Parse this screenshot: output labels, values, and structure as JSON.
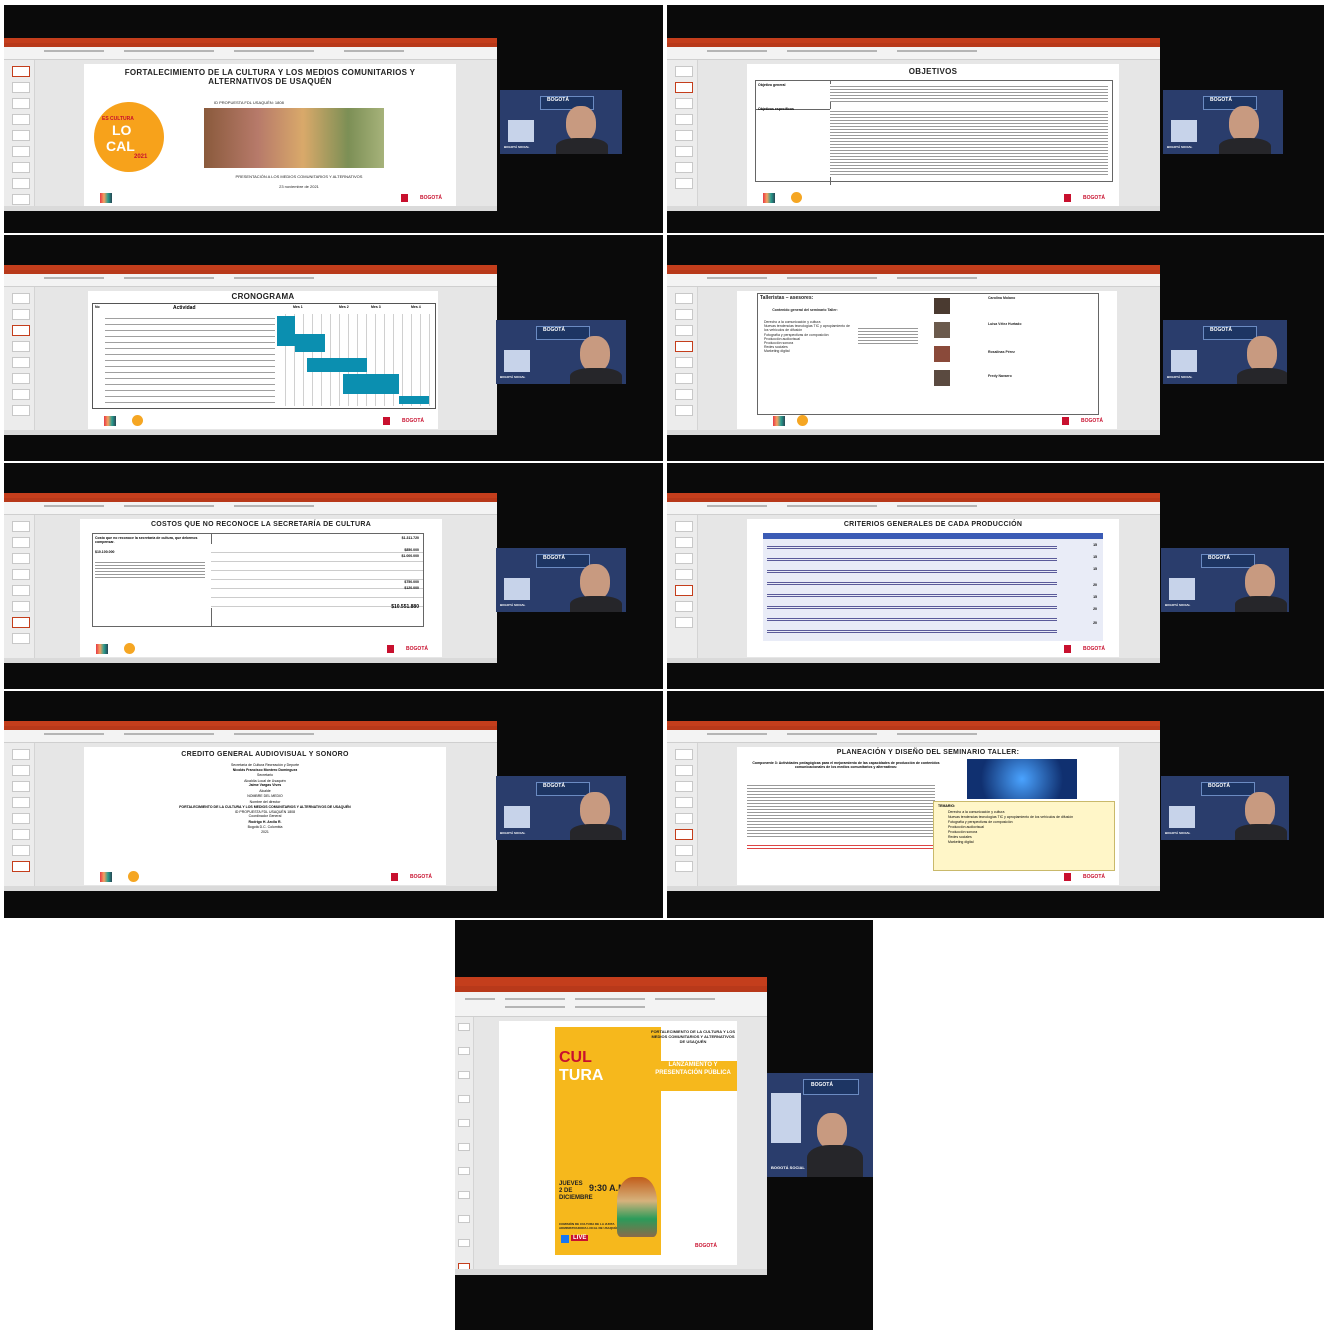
{
  "screens": [
    {
      "slide_title": "FORTALECIMIENTO DE LA CULTURA Y LOS MEDIOS COMUNITARIOS Y ALTERNATIVOS DE USAQUÉN",
      "project_id": "ID PROPUESTA FDL USAQUÉN: 1808",
      "logo_es_cultura": "ES CULTURA",
      "logo_lo": "LO",
      "logo_cal": "CAL",
      "logo_year": "2021",
      "presentation": "PRESENTACIÓN A LOS MEDIOS COMUNITARIOS Y ALTERNATIVOS",
      "date": "23 noviembre de 2021",
      "bogota": "BOGOTÁ"
    },
    {
      "slide_title": "OBJETIVOS",
      "row1_label": "Objetivo general",
      "row2_label": "Objetivos específicos",
      "bogota": "BOGOTÁ"
    },
    {
      "slide_title": "CRONOGRAMA",
      "col_activity": "Actividad",
      "col_no": "No",
      "months": [
        "Mes 1",
        "Mes 2",
        "Mes 3",
        "Mes 4"
      ],
      "bogota": "BOGOTÁ"
    },
    {
      "heading": "Talleristas – asesores:",
      "subheading": "Contenido general del seminario Taller:",
      "topics": [
        "Derecho a la comunicación y cultura",
        "Nuevas tendencias tecnologías TIC y apropiamiento de los vehículos de difusión",
        "Fotografía y perspectivas de composición",
        "Producción audiovisual",
        "Producción sonora",
        "Redes sociales",
        "Marketing digital"
      ],
      "people": [
        "Carolina Molano",
        "Luisa Vélez Hurtado",
        "Rosalinas Pérez",
        "Fredy Navarro"
      ],
      "bogota": "BOGOTÁ"
    },
    {
      "slide_title": "COSTOS QUE NO RECONOCE LA SECRETARÍA DE CULTURA",
      "left_heading": "Costo que no reconoce la secretaría de cultura, que debemos compensar.",
      "left_amount": "$10.100.000",
      "amounts": [
        "$1.311.720",
        "$850.000",
        "$1.000.000",
        "$750.000",
        "$120.000"
      ],
      "total": "$10.551.880",
      "bogota": "BOGOTÁ"
    },
    {
      "slide_title": "CRITERIOS GENERALES DE CADA PRODUCCIÓN",
      "scores": [
        "15",
        "15",
        "15",
        "20",
        "15",
        "20",
        "20"
      ],
      "bogota": "BOGOTÁ"
    },
    {
      "slide_title": "CREDITO GENERAL  AUDIOVISUAL Y SONORO",
      "lines": [
        "Secretaría de Cultura Recreación y Deporte",
        "Nicolás Francisco Montero Domínguez",
        "Secretario",
        "Alcaldía Local de Usaquén",
        "Jaime Vargas Vives",
        "Alcalde",
        "NOMBRE DEL MEDIO",
        "Nombre del director",
        "FORTALECIMIENTO DE LA CULTURA Y LOS MEDIOS COMUNITARIOS Y ALTERNATIVOS DE USAQUÉN",
        "ID PROPUESTA FDL USAQUÉN 1808",
        "Coordinador General",
        "Rodrigo H. Arcila R.",
        "Bogotá D.C. Colombia",
        "2021"
      ],
      "bogota": "BOGOTÁ"
    },
    {
      "slide_title": "PLANEACIÓN Y DISEÑO DEL SEMINARIO TALLER:",
      "component": "Componente 3: Actividades pedagógicas para el mejoramiento de las capacidades de producción de contenidos comunicacionales de los medios comunitarios y alternativos:",
      "temario_label": "TEMARIO:",
      "temario": [
        "Derecho a la comunicación y cultura",
        "Nuevas tendencias tecnologías TIC y apropiamiento de los vehículos de difusión",
        "Fotografía y perspectivas de composición",
        "Producción audiovisual",
        "Producción sonora",
        "Redes sociales",
        "Marketing digital"
      ],
      "bogota": "BOGOTÁ"
    },
    {
      "poster_title": "FORTALECIMIENTO DE LA CULTURA Y LOS MEDIOS COMUNITARIOS Y ALTERNATIVOS DE USAQUÉN",
      "poster_cul": "CUL",
      "poster_tura": "TURA",
      "poster_launch": "LANZAMIENTO Y PRESENTACIÓN PÚBLICA",
      "poster_day": "JUEVES 2 DE DICIEMBRE",
      "poster_time": "9:30 A.M.",
      "poster_org": "COMISIÓN DE CULTURA DE LA JUNTA ADMINISTRADORA LOCAL DE USAQUÉN",
      "poster_live": "LIVE",
      "bogota": "BOGOTÁ"
    }
  ],
  "video": {
    "sign": "BOGOTÁ",
    "caption": "BOGOTÁ SOCIAL",
    "side": "BOGOTÁ SOCIAL TELEVISIÓN"
  }
}
